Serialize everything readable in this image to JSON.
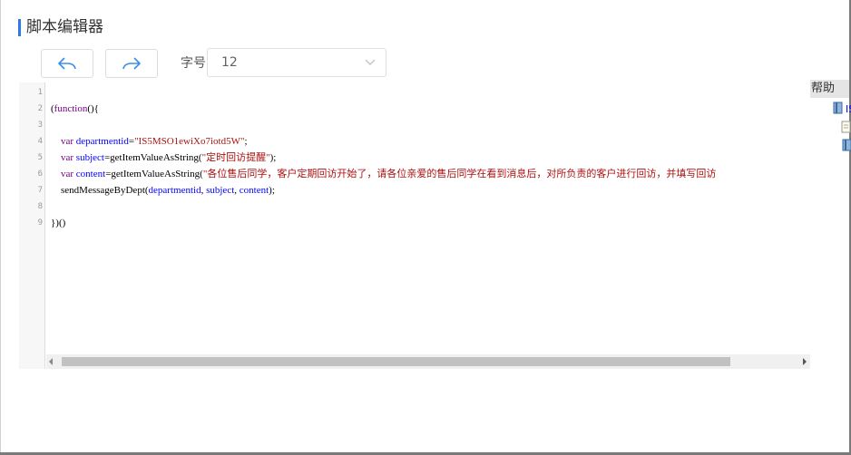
{
  "page": {
    "title": "脚本编辑器"
  },
  "toolbar": {
    "undo_icon": "undo-arrow-icon",
    "redo_icon": "redo-arrow-icon",
    "font_size_label": "字号",
    "font_size_value": "12",
    "accent_color": "#2b7be5"
  },
  "editor": {
    "line_numbers": [
      "1",
      "2",
      "3",
      "4",
      "5",
      "6",
      "7",
      "8",
      "9"
    ],
    "lines": [
      {
        "tokens": []
      },
      {
        "tokens": [
          {
            "t": "(",
            "c": "plain"
          },
          {
            "t": "function",
            "c": "kw"
          },
          {
            "t": "(){",
            "c": "plain"
          }
        ]
      },
      {
        "tokens": []
      },
      {
        "tokens": [
          {
            "t": "    ",
            "c": "plain"
          },
          {
            "t": "var",
            "c": "kw"
          },
          {
            "t": " ",
            "c": "plain"
          },
          {
            "t": "departmentid",
            "c": "var"
          },
          {
            "t": "=",
            "c": "plain"
          },
          {
            "t": "\"IS5MSO1ewiXo7iotd5W\"",
            "c": "str"
          },
          {
            "t": ";",
            "c": "plain"
          }
        ]
      },
      {
        "tokens": [
          {
            "t": "    ",
            "c": "plain"
          },
          {
            "t": "var",
            "c": "kw"
          },
          {
            "t": " ",
            "c": "plain"
          },
          {
            "t": "subject",
            "c": "var"
          },
          {
            "t": "=getItemValueAsString(",
            "c": "plain"
          },
          {
            "t": "\"定时回访提醒\"",
            "c": "str"
          },
          {
            "t": ");",
            "c": "plain"
          }
        ]
      },
      {
        "tokens": [
          {
            "t": "    ",
            "c": "plain"
          },
          {
            "t": "var",
            "c": "kw"
          },
          {
            "t": " ",
            "c": "plain"
          },
          {
            "t": "content",
            "c": "var"
          },
          {
            "t": "=getItemValueAsString(",
            "c": "plain"
          },
          {
            "t": "\"各位售后同学，客户定期回访开始了，请各位亲爱的售后同学在看到消息后，对所负责的客户进行回访，并填写回访",
            "c": "str"
          }
        ]
      },
      {
        "tokens": [
          {
            "t": "    sendMessageByDept(",
            "c": "plain"
          },
          {
            "t": "departmentid",
            "c": "var"
          },
          {
            "t": ", ",
            "c": "plain"
          },
          {
            "t": "subject",
            "c": "var"
          },
          {
            "t": ", ",
            "c": "plain"
          },
          {
            "t": "content",
            "c": "var"
          },
          {
            "t": ");",
            "c": "plain"
          }
        ]
      },
      {
        "tokens": []
      },
      {
        "tokens": [
          {
            "t": "})()",
            "c": "plain"
          }
        ]
      }
    ]
  },
  "help": {
    "title": "帮助",
    "tree_partial_label": "IS"
  }
}
